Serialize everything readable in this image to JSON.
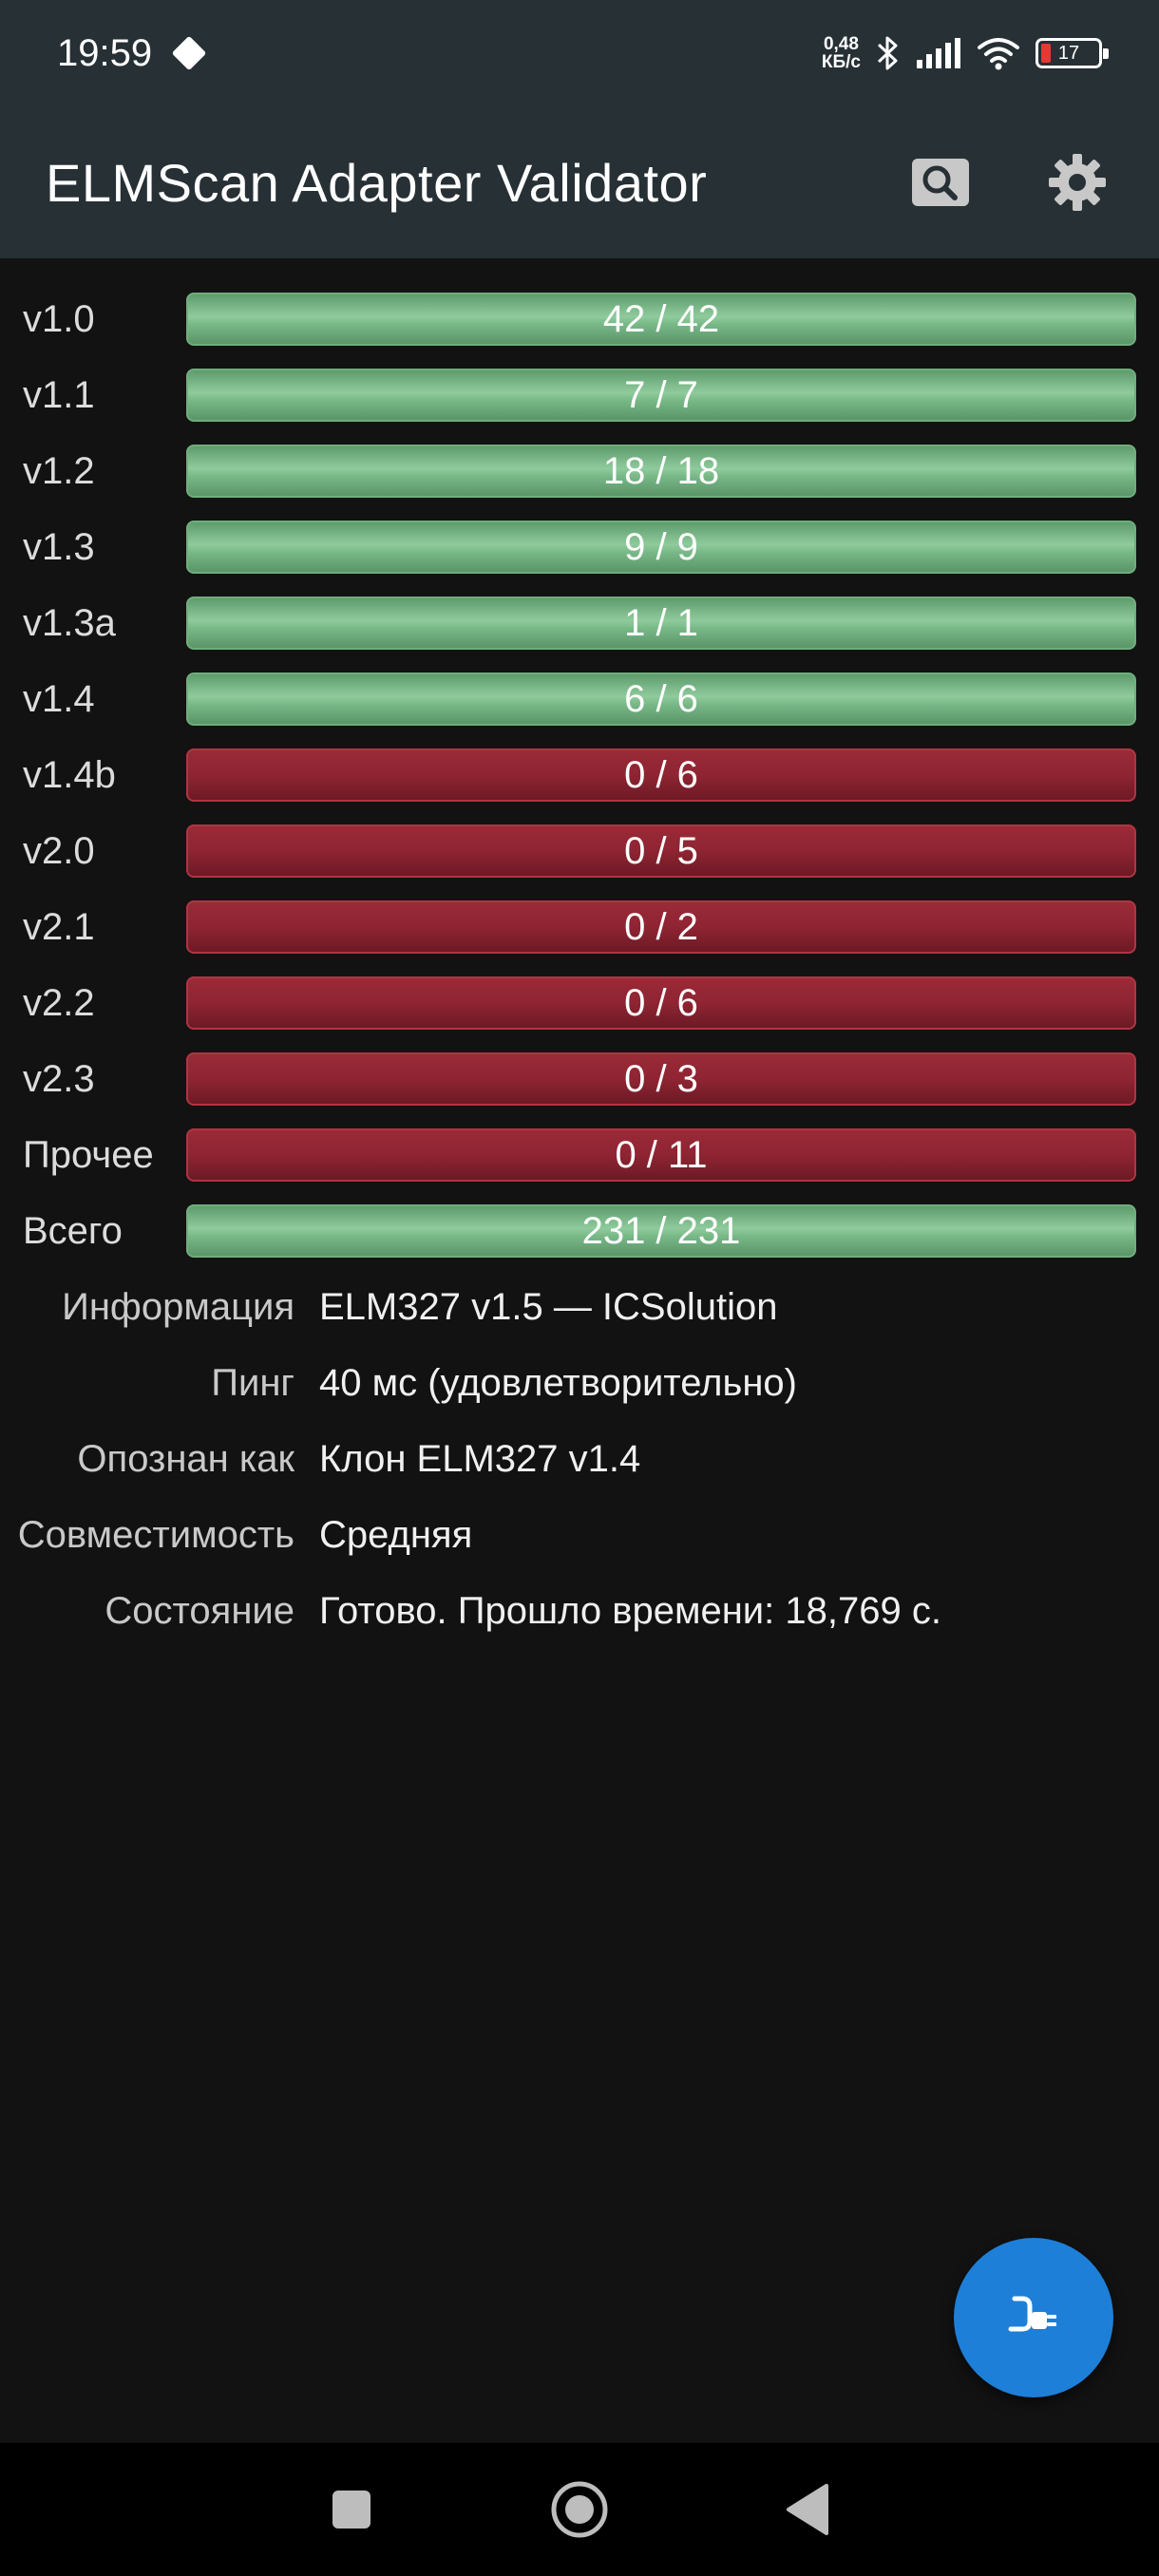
{
  "status_bar": {
    "time": "19:59",
    "net_speed_value": "0,48",
    "net_speed_unit": "КБ/с",
    "battery_level": "17"
  },
  "app_bar": {
    "title": "ELMScan Adapter Validator",
    "search_icon": "search-icon",
    "settings_icon": "gear-icon"
  },
  "results": [
    {
      "label": "v1.0",
      "value": "42 / 42",
      "status": "pass"
    },
    {
      "label": "v1.1",
      "value": "7 / 7",
      "status": "pass"
    },
    {
      "label": "v1.2",
      "value": "18 / 18",
      "status": "pass"
    },
    {
      "label": "v1.3",
      "value": "9 / 9",
      "status": "pass"
    },
    {
      "label": "v1.3a",
      "value": "1 / 1",
      "status": "pass"
    },
    {
      "label": "v1.4",
      "value": "6 / 6",
      "status": "pass"
    },
    {
      "label": "v1.4b",
      "value": "0 / 6",
      "status": "fail"
    },
    {
      "label": "v2.0",
      "value": "0 / 5",
      "status": "fail"
    },
    {
      "label": "v2.1",
      "value": "0 / 2",
      "status": "fail"
    },
    {
      "label": "v2.2",
      "value": "0 / 6",
      "status": "fail"
    },
    {
      "label": "v2.3",
      "value": "0 / 3",
      "status": "fail"
    },
    {
      "label": "Прочее",
      "value": "0 / 11",
      "status": "fail"
    },
    {
      "label": "Всего",
      "value": "231 / 231",
      "status": "pass"
    }
  ],
  "info": [
    {
      "label": "Информация",
      "value": "ELM327 v1.5 — ICSolution"
    },
    {
      "label": "Пинг",
      "value": "40 мс (удовлетворительно)"
    },
    {
      "label": "Опознан как",
      "value": "Клон ELM327 v1.4"
    },
    {
      "label": "Совместимость",
      "value": "Средняя"
    },
    {
      "label": "Состояние",
      "value": "Готово. Прошло времени: 18,769 с."
    }
  ],
  "fab": {
    "icon": "plug-connect-icon"
  },
  "colors": {
    "app_bar": "#263035",
    "background": "#121212",
    "pass": "#7cbd8a",
    "fail": "#8f2432",
    "fab": "#1e7fd8"
  }
}
